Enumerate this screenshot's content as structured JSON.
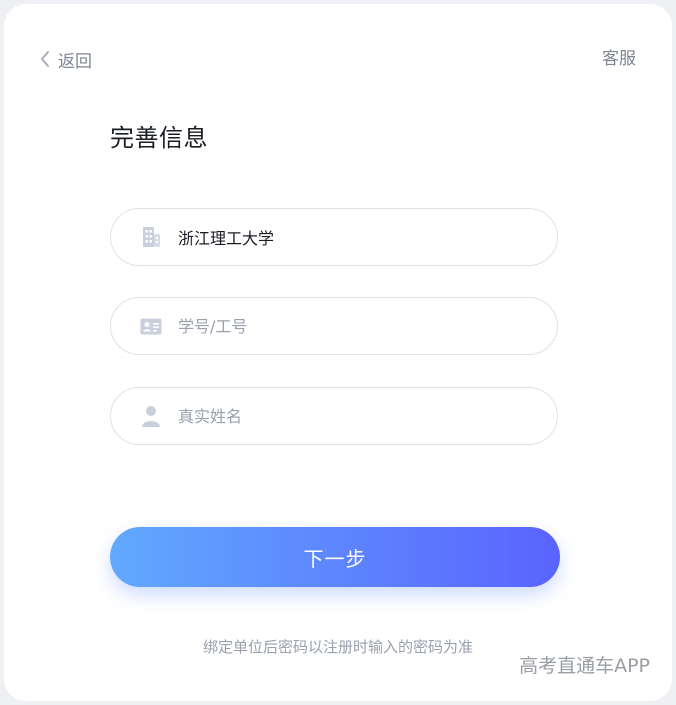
{
  "header": {
    "back_label": "返回",
    "service_label": "客服"
  },
  "page": {
    "title": "完善信息"
  },
  "form": {
    "school": {
      "value": "浙江理工大学",
      "placeholder": ""
    },
    "student_id": {
      "value": "",
      "placeholder": "学号/工号"
    },
    "real_name": {
      "value": "",
      "placeholder": "真实姓名"
    }
  },
  "actions": {
    "next_label": "下一步"
  },
  "hint": "绑定单位后密码以注册时输入的密码为准",
  "watermark": "高考直通车APP",
  "colors": {
    "gradient_start": "#61a9fe",
    "gradient_end": "#5a63fe",
    "icon_color": "#c9d0dc"
  },
  "icons": {
    "back": "chevron-left-icon",
    "school": "building-icon",
    "id": "id-card-icon",
    "name": "user-icon"
  }
}
